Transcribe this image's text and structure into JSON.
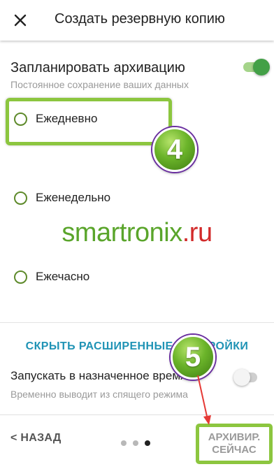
{
  "header": {
    "title": "Создать резервную копию",
    "close_icon": "close-icon"
  },
  "schedule": {
    "title": "Запланировать архивацию",
    "subtitle": "Постоянное сохранение ваших данных",
    "enabled": true
  },
  "frequency": {
    "options": [
      {
        "label": "Ежедневно",
        "selected": false
      },
      {
        "label": "Еженедельно",
        "selected": false
      },
      {
        "label": "Ежечасно",
        "selected": false
      }
    ]
  },
  "annotations": {
    "badge_1": "4",
    "badge_2": "5",
    "highlight_color": "#8cc63f",
    "arrow_color": "#e53935"
  },
  "watermark": {
    "green_part": "smartronix",
    "red_part": ".ru"
  },
  "advanced": {
    "hide_link": "СКРЫТЬ РАСШИРЕННЫЕ НАСТРОЙКИ",
    "run_title": "Запускать в назначенное время",
    "run_subtitle": "Временно выводит из спящего режима",
    "run_enabled": false
  },
  "footer": {
    "back_label": "< НАЗАД",
    "page_dots": 3,
    "active_dot": 3,
    "backup_line1": "АРХИВИР.",
    "backup_line2": "СЕЙЧАС"
  },
  "colors": {
    "accent_green": "#43a047",
    "link_blue": "#1f93b5",
    "radio_border": "#5e8a2b"
  }
}
